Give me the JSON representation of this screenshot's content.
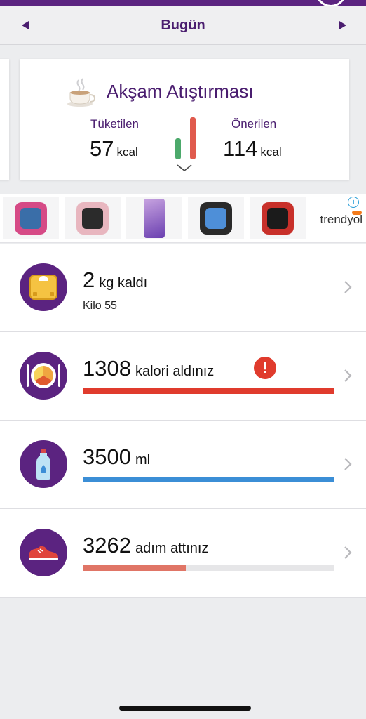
{
  "header": {
    "date_label": "Bugün",
    "prev_icon": "triangle-left-icon",
    "next_icon": "triangle-right-icon"
  },
  "meal_card": {
    "title": "Akşam Atıştırması",
    "icon": "coffee-cup-icon",
    "consumed_label": "Tüketilen",
    "consumed_value": "57",
    "consumed_unit": "kcal",
    "recommended_label": "Önerilen",
    "recommended_value": "114",
    "recommended_unit": "kcal",
    "bar_consumed_fraction": 0.5,
    "colors": {
      "consumed": "#4ca96b",
      "recommended": "#e05a4d",
      "title": "#4a1d6f"
    }
  },
  "ad": {
    "brand": "trendyol",
    "info_icon": "info-icon",
    "products": [
      "kids-smartwatch-pink",
      "smartwatch-pink",
      "smartphone-purple",
      "smartwatch-black",
      "smartwatch-red"
    ]
  },
  "rows": {
    "weight": {
      "value": "2",
      "suffix": "kg kaldı",
      "sub": "Kilo 55",
      "icon": "scale-icon"
    },
    "calories": {
      "value": "1308",
      "suffix": "kalori aldınız",
      "icon": "plate-icon",
      "warning_icon": "exclamation-icon",
      "warning_glyph": "!",
      "progress": 1.0,
      "color": "#e03b2d"
    },
    "water": {
      "value": "3500",
      "suffix": "ml",
      "icon": "water-bottle-icon",
      "progress": 1.0,
      "color": "#3b8ed6"
    },
    "steps": {
      "value": "3262",
      "suffix": "adım attınız",
      "icon": "sneaker-icon",
      "progress": 0.41,
      "color": "#e07566"
    }
  },
  "colors": {
    "brand_purple": "#5b2380",
    "background": "#ecedef"
  }
}
